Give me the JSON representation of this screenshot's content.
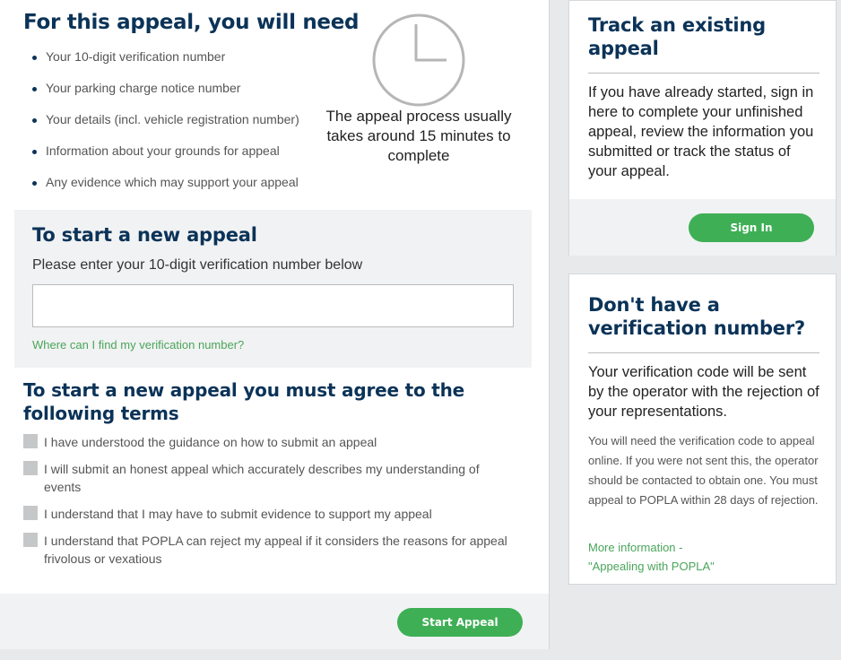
{
  "requirements": {
    "title": "For this appeal, you will need",
    "items": [
      "Your 10-digit verification number",
      "Your parking charge notice number",
      "Your details (incl. vehicle registration number)",
      "Information about your grounds for appeal",
      "Any evidence which may support your appeal"
    ],
    "clock_icon": "clock-icon",
    "duration_text": "The appeal process usually takes around 15 minutes to complete"
  },
  "new_appeal": {
    "title": "To start a new appeal",
    "instruction": "Please enter your 10-digit verification number below",
    "input_value": "",
    "input_placeholder": "",
    "help_link": "Where can I find my verification number?"
  },
  "terms": {
    "title": "To start a new appeal you must agree to the following terms",
    "items": [
      "I have understood the guidance on how to submit an appeal",
      "I will submit an honest appeal which accurately describes my understanding of events",
      "I understand that I may have to submit evidence to support my appeal",
      "I understand that POPLA can reject my appeal if it considers the reasons for appeal frivolous or vexatious"
    ]
  },
  "footer": {
    "start_button": "Start Appeal"
  },
  "track": {
    "title": "Track an existing appeal",
    "body": "If you have already started, sign in here to complete your unfinished appeal, review the information you submitted or track the status of your appeal.",
    "sign_in_button": "Sign In"
  },
  "no_verification": {
    "title": "Don't have a verification number?",
    "lead": "Your verification code will be sent by the operator with the rejection of your representations.",
    "detail": "You will need the verification code to appeal online. If you were not sent this, the operator should be contacted to obtain one. You must appeal to POPLA within 28 days of rejection.",
    "more_link_line1": "More information -",
    "more_link_line2": "\"Appealing with POPLA\""
  },
  "colors": {
    "navy": "#0b3358",
    "green": "#3eaf55",
    "link_green": "#4aa55a",
    "panel_grey": "#f1f2f3",
    "checkbox_grey": "#c6c7c8"
  }
}
